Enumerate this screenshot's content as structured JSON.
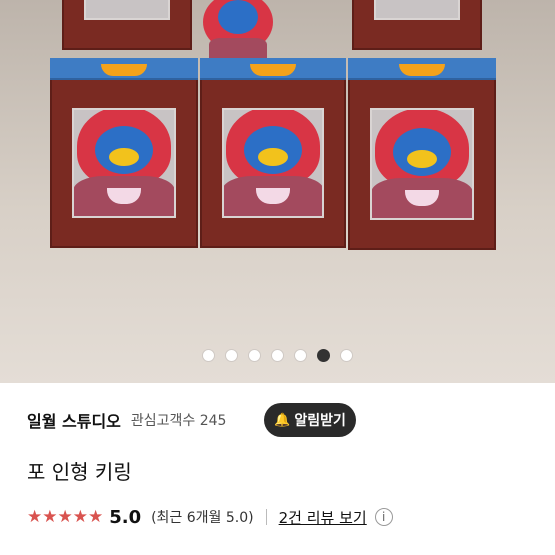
{
  "carousel": {
    "total": 7,
    "active_index": 5
  },
  "shop": {
    "name": "일월 스튜디오",
    "followers_label": "관심고객수 245",
    "notify_label": "알림받기",
    "notify_icon": "bell-icon"
  },
  "product": {
    "title": "포 인형 키링"
  },
  "rating": {
    "stars": "★★★★★",
    "score": "5.0",
    "recent": "(최근 6개월 5.0)",
    "reviews_link": "2건 리뷰 보기",
    "info_icon": "i",
    "star_color": "#d9534f"
  },
  "colors": {
    "notify_bg": "#2a2a2a",
    "box": "#7a2a22",
    "lid": "#3e7cc4"
  }
}
